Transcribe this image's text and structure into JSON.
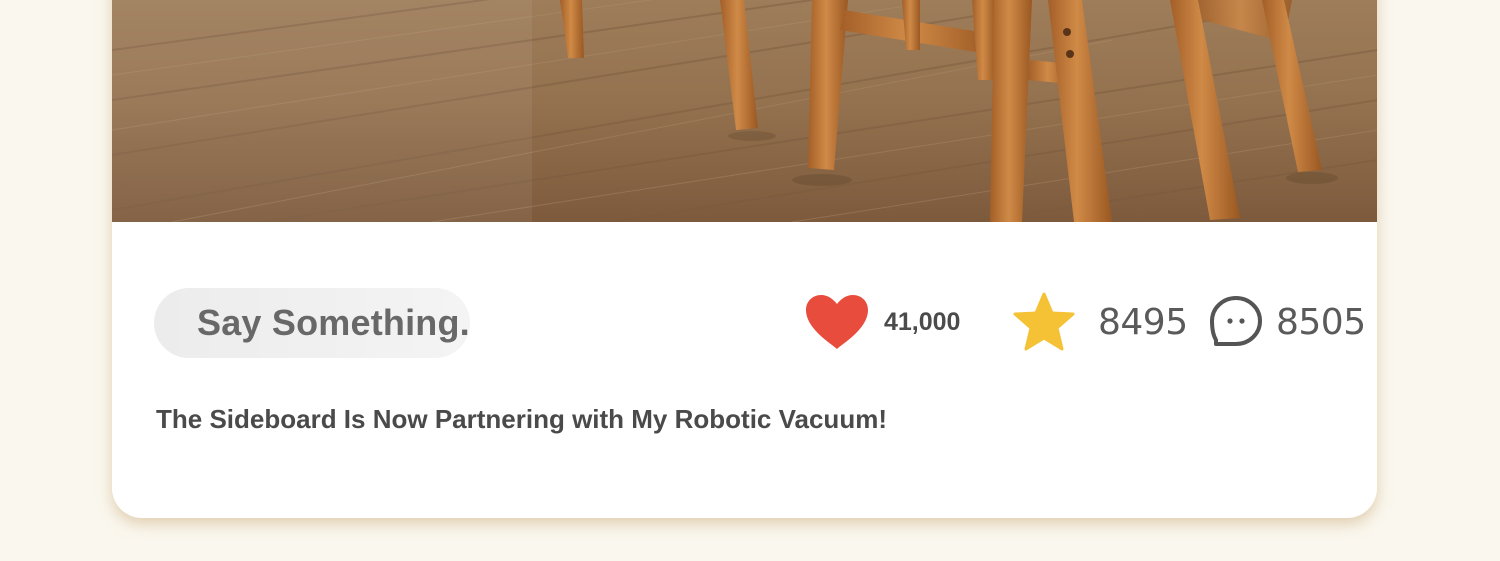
{
  "post": {
    "photo_alt": "Wooden chairs on oak floor",
    "comment_placeholder": "Say Something.",
    "likes": "41,000",
    "favorites": "8495",
    "comments": "8505",
    "title": "The Sideboard Is Now Partnering with My Robotic Vacuum!"
  },
  "icons": {
    "like": "heart-icon",
    "favorite": "star-icon",
    "comment": "comment-bubble-icon"
  },
  "colors": {
    "heart": "#e84c3d",
    "star": "#f4c234",
    "page_background": "#faf7ee"
  }
}
